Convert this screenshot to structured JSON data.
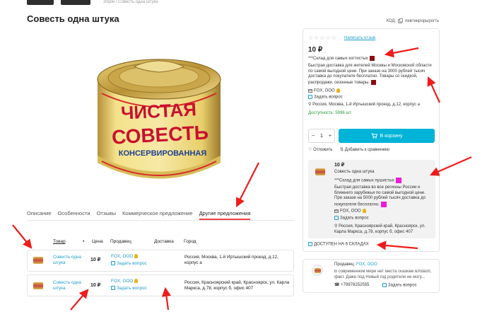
{
  "breadcrumb": {
    "tail": "згорiи  /  Совесть одна штука"
  },
  "page": {
    "title": "Совесть одна штука"
  },
  "code": {
    "label": "ХОД:",
    "value": "певтинрорырогть"
  },
  "product_image": {
    "line1": "ЧИСТАЯ",
    "line2": "СОВЕСТЬ",
    "line3": "КОНСЕРВИРОВАННАЯ"
  },
  "tabs": [
    {
      "label": "Описание"
    },
    {
      "label": "Особенности"
    },
    {
      "label": "Отзывы"
    },
    {
      "label": "Коммерческое предложение"
    },
    {
      "label": "Другие предложения"
    }
  ],
  "table": {
    "headers": {
      "product": "Товар",
      "dot": "•",
      "price": "Цена",
      "seller": "Продавец",
      "delivery": "Доставка",
      "city": "Город"
    },
    "rows": [
      {
        "product": "Совесть одна штука",
        "price": "10 ₽",
        "seller": "FOX, ООО",
        "ask": "Задать вопрос",
        "city": "Россия, Москва, 1-й Иртышский проезд, д.12, корпус а"
      },
      {
        "product": "Совесть одна штука",
        "price": "10 ₽",
        "seller": "FOX, ООО",
        "ask": "Задать вопрос",
        "city": "Россия, Красноярский край, Красноярск, ул. Карла Маркса, д.78, корпус б, офис 407"
      }
    ]
  },
  "buybox": {
    "stars": "☆☆☆☆☆",
    "write_review": "Написать отзыв",
    "price": "10 ₽",
    "warehouse": "***Склад для самых когтистых",
    "delivery_text": "Быстрая доставка для жителей Москвы и Московской области по самой выгодной цене. При заказе на 3000 рублей тысяч доставка до покупателя бесплатно. Товары со скидкой, распродажи, сезонные товары.",
    "seller": "FOX, ООО",
    "ask": "Задать вопрос",
    "address": "Россия, Москва, 1-й Иртышский проезд, д.12, корпус а",
    "stock": "Доступность: 5996 шт.",
    "qty": "1",
    "minus": "−",
    "plus": "+",
    "cart": "В корзину",
    "defer": "Отложить",
    "compare": "Добавить к сравнению"
  },
  "offer": {
    "price": "10 ₽",
    "name": "Совесть одна штука",
    "warehouse": "***Склад для самых пушистых",
    "delivery_text": "Быстрая доставка во все регионы России и ближнего зарубежья по самой выгодной цене. При заказе на 5000 рублей тысяч доставка до покупателя бесплатно.",
    "seller": "FOX, ООО",
    "ask": "Задать вопрос",
    "address": "Россия, Красноярский край, Красноярск, ул. Карла Маркса, д.78, корпус б, офис 407"
  },
  "availability": {
    "label": "ДОСТУПЕН НА 6 СКЛАДАХ"
  },
  "seller_card": {
    "label": "Продавец:",
    "name": "FOX, ООО",
    "desc": "В современном мире нет места сказкам &mdash; факт. Даже под Новый год родители не могу...",
    "phone": "+79978252555",
    "ask": "Задать вопрос"
  },
  "colors": {
    "accent": "#00b3d7",
    "link": "#1a9ec7",
    "arrow": "#ee1c1c",
    "swatch_red": "#8b0c10",
    "swatch_pink": "#ee1bd8"
  }
}
